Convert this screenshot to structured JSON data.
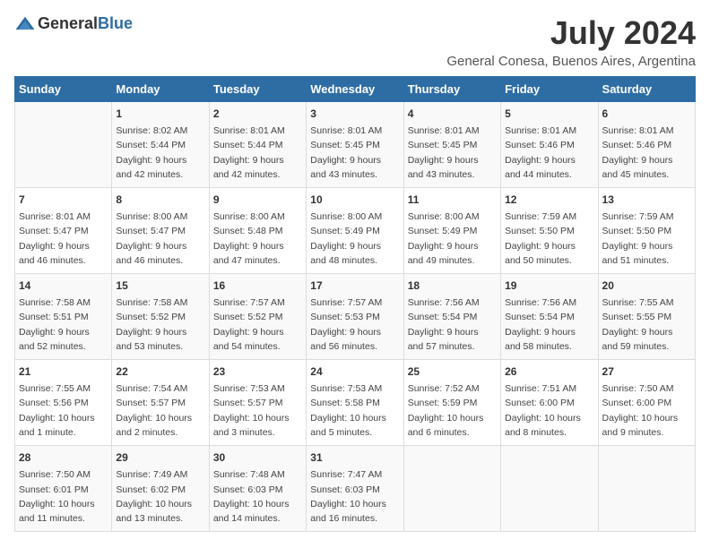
{
  "header": {
    "logo_general": "General",
    "logo_blue": "Blue",
    "month": "July 2024",
    "location": "General Conesa, Buenos Aires, Argentina"
  },
  "days_of_week": [
    "Sunday",
    "Monday",
    "Tuesday",
    "Wednesday",
    "Thursday",
    "Friday",
    "Saturday"
  ],
  "weeks": [
    [
      {
        "day": "",
        "info": ""
      },
      {
        "day": "1",
        "info": "Sunrise: 8:02 AM\nSunset: 5:44 PM\nDaylight: 9 hours\nand 42 minutes."
      },
      {
        "day": "2",
        "info": "Sunrise: 8:01 AM\nSunset: 5:44 PM\nDaylight: 9 hours\nand 42 minutes."
      },
      {
        "day": "3",
        "info": "Sunrise: 8:01 AM\nSunset: 5:45 PM\nDaylight: 9 hours\nand 43 minutes."
      },
      {
        "day": "4",
        "info": "Sunrise: 8:01 AM\nSunset: 5:45 PM\nDaylight: 9 hours\nand 43 minutes."
      },
      {
        "day": "5",
        "info": "Sunrise: 8:01 AM\nSunset: 5:46 PM\nDaylight: 9 hours\nand 44 minutes."
      },
      {
        "day": "6",
        "info": "Sunrise: 8:01 AM\nSunset: 5:46 PM\nDaylight: 9 hours\nand 45 minutes."
      }
    ],
    [
      {
        "day": "7",
        "info": "Sunrise: 8:01 AM\nSunset: 5:47 PM\nDaylight: 9 hours\nand 46 minutes."
      },
      {
        "day": "8",
        "info": "Sunrise: 8:00 AM\nSunset: 5:47 PM\nDaylight: 9 hours\nand 46 minutes."
      },
      {
        "day": "9",
        "info": "Sunrise: 8:00 AM\nSunset: 5:48 PM\nDaylight: 9 hours\nand 47 minutes."
      },
      {
        "day": "10",
        "info": "Sunrise: 8:00 AM\nSunset: 5:49 PM\nDaylight: 9 hours\nand 48 minutes."
      },
      {
        "day": "11",
        "info": "Sunrise: 8:00 AM\nSunset: 5:49 PM\nDaylight: 9 hours\nand 49 minutes."
      },
      {
        "day": "12",
        "info": "Sunrise: 7:59 AM\nSunset: 5:50 PM\nDaylight: 9 hours\nand 50 minutes."
      },
      {
        "day": "13",
        "info": "Sunrise: 7:59 AM\nSunset: 5:50 PM\nDaylight: 9 hours\nand 51 minutes."
      }
    ],
    [
      {
        "day": "14",
        "info": "Sunrise: 7:58 AM\nSunset: 5:51 PM\nDaylight: 9 hours\nand 52 minutes."
      },
      {
        "day": "15",
        "info": "Sunrise: 7:58 AM\nSunset: 5:52 PM\nDaylight: 9 hours\nand 53 minutes."
      },
      {
        "day": "16",
        "info": "Sunrise: 7:57 AM\nSunset: 5:52 PM\nDaylight: 9 hours\nand 54 minutes."
      },
      {
        "day": "17",
        "info": "Sunrise: 7:57 AM\nSunset: 5:53 PM\nDaylight: 9 hours\nand 56 minutes."
      },
      {
        "day": "18",
        "info": "Sunrise: 7:56 AM\nSunset: 5:54 PM\nDaylight: 9 hours\nand 57 minutes."
      },
      {
        "day": "19",
        "info": "Sunrise: 7:56 AM\nSunset: 5:54 PM\nDaylight: 9 hours\nand 58 minutes."
      },
      {
        "day": "20",
        "info": "Sunrise: 7:55 AM\nSunset: 5:55 PM\nDaylight: 9 hours\nand 59 minutes."
      }
    ],
    [
      {
        "day": "21",
        "info": "Sunrise: 7:55 AM\nSunset: 5:56 PM\nDaylight: 10 hours\nand 1 minute."
      },
      {
        "day": "22",
        "info": "Sunrise: 7:54 AM\nSunset: 5:57 PM\nDaylight: 10 hours\nand 2 minutes."
      },
      {
        "day": "23",
        "info": "Sunrise: 7:53 AM\nSunset: 5:57 PM\nDaylight: 10 hours\nand 3 minutes."
      },
      {
        "day": "24",
        "info": "Sunrise: 7:53 AM\nSunset: 5:58 PM\nDaylight: 10 hours\nand 5 minutes."
      },
      {
        "day": "25",
        "info": "Sunrise: 7:52 AM\nSunset: 5:59 PM\nDaylight: 10 hours\nand 6 minutes."
      },
      {
        "day": "26",
        "info": "Sunrise: 7:51 AM\nSunset: 6:00 PM\nDaylight: 10 hours\nand 8 minutes."
      },
      {
        "day": "27",
        "info": "Sunrise: 7:50 AM\nSunset: 6:00 PM\nDaylight: 10 hours\nand 9 minutes."
      }
    ],
    [
      {
        "day": "28",
        "info": "Sunrise: 7:50 AM\nSunset: 6:01 PM\nDaylight: 10 hours\nand 11 minutes."
      },
      {
        "day": "29",
        "info": "Sunrise: 7:49 AM\nSunset: 6:02 PM\nDaylight: 10 hours\nand 13 minutes."
      },
      {
        "day": "30",
        "info": "Sunrise: 7:48 AM\nSunset: 6:03 PM\nDaylight: 10 hours\nand 14 minutes."
      },
      {
        "day": "31",
        "info": "Sunrise: 7:47 AM\nSunset: 6:03 PM\nDaylight: 10 hours\nand 16 minutes."
      },
      {
        "day": "",
        "info": ""
      },
      {
        "day": "",
        "info": ""
      },
      {
        "day": "",
        "info": ""
      }
    ]
  ]
}
